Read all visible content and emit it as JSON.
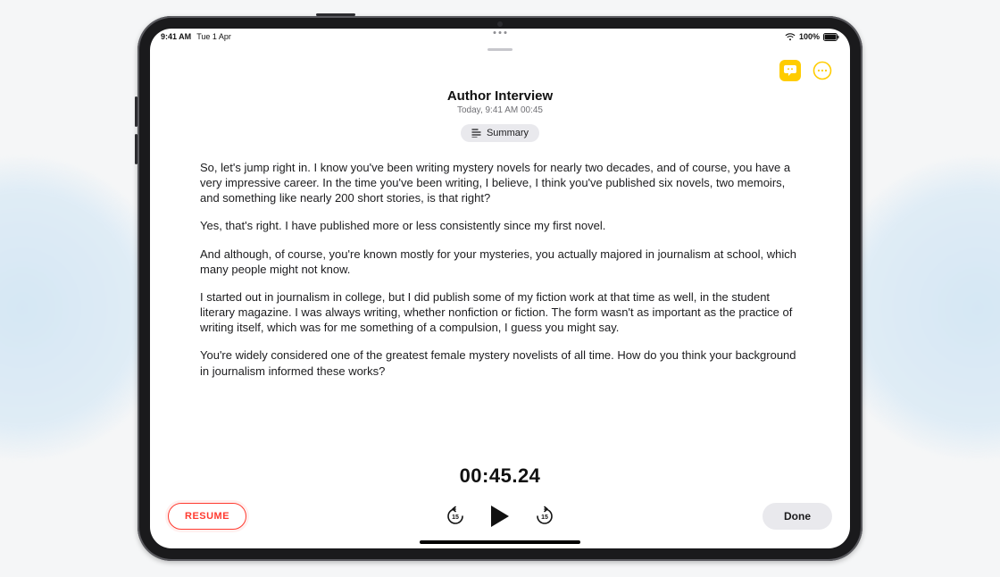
{
  "status": {
    "time": "9:41 AM",
    "date": "Tue 1 Apr",
    "battery_pct": "100%"
  },
  "recording": {
    "title": "Author Interview",
    "subtitle": "Today, 9:41 AM  00:45",
    "summary_label": "Summary"
  },
  "transcript": {
    "p1": "So, let's jump right in. I know you've been writing mystery novels for nearly two decades, and of course, you have a very impressive career. In the time you've been writing, I believe, I think you've published six novels, two memoirs, and something like nearly 200 short stories, is that right?",
    "p2": "Yes, that's right. I have published more or less consistently since my first novel.",
    "p3": "And although, of course, you're known mostly for your mysteries, you actually majored in journalism at school, which many people might not know.",
    "p4": "I started out in journalism in college, but I did publish some of my fiction work at that time as well, in the student literary magazine. I was always writing, whether nonfiction or fiction. The form wasn't as important as the practice of writing itself, which was for me something of a compulsion, I guess you might say.",
    "p5": "You're widely considered one of the greatest female mystery novelists of all time. How do you think your background in journalism informed these works?"
  },
  "playback": {
    "timecode": "00:45.24",
    "skip_seconds": "15",
    "resume_label": "RESUME",
    "done_label": "Done"
  },
  "colors": {
    "accent_yellow": "#ffcc00",
    "accent_red": "#ff3b30"
  }
}
